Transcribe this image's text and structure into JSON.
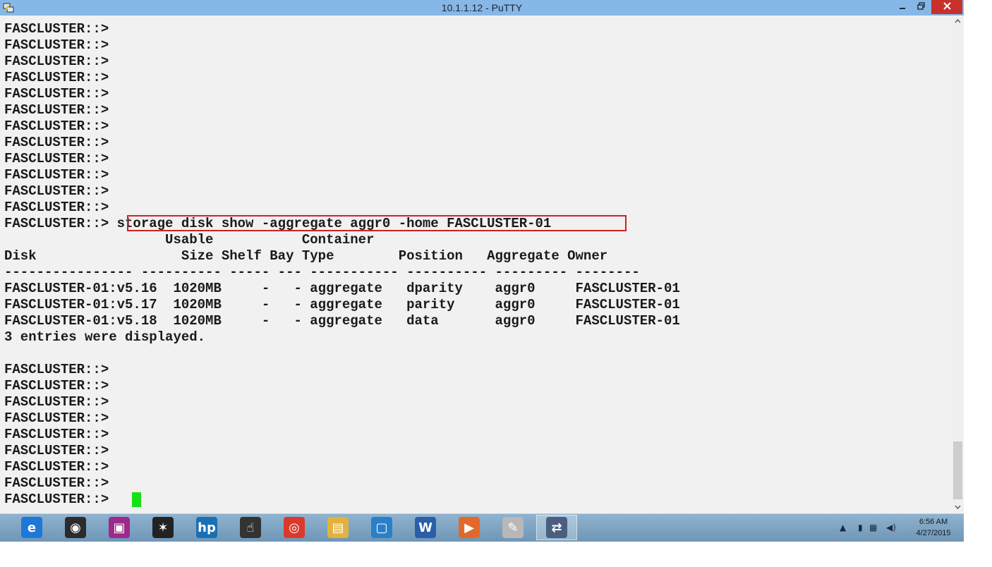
{
  "window": {
    "title": "10.1.1.12 - PuTTY",
    "minimize_icon": "minimize-icon",
    "restore_icon": "restore-icon",
    "close_icon": "close-icon"
  },
  "terminal": {
    "lines": [
      "FASCLUSTER::>",
      "FASCLUSTER::>",
      "FASCLUSTER::>",
      "FASCLUSTER::>",
      "FASCLUSTER::>",
      "FASCLUSTER::>",
      "FASCLUSTER::>",
      "FASCLUSTER::>",
      "FASCLUSTER::>",
      "FASCLUSTER::>",
      "FASCLUSTER::>",
      "FASCLUSTER::>",
      "FASCLUSTER::> storage disk show -aggregate aggr0 -home FASCLUSTER-01",
      "                    Usable           Container",
      "Disk                  Size Shelf Bay Type        Position   Aggregate Owner",
      "---------------- ---------- ----- --- ----------- ---------- --------- --------",
      "FASCLUSTER-01:v5.16  1020MB     -   - aggregate   dparity    aggr0     FASCLUSTER-01",
      "FASCLUSTER-01:v5.17  1020MB     -   - aggregate   parity     aggr0     FASCLUSTER-01",
      "FASCLUSTER-01:v5.18  1020MB     -   - aggregate   data       aggr0     FASCLUSTER-01",
      "3 entries were displayed.",
      "",
      "FASCLUSTER::>",
      "FASCLUSTER::>",
      "FASCLUSTER::>",
      "FASCLUSTER::>",
      "FASCLUSTER::>",
      "FASCLUSTER::>",
      "FASCLUSTER::>",
      "FASCLUSTER::>",
      "FASCLUSTER::>"
    ],
    "highlighted_command": "storage disk show -aggregate aggr0 -home FASCLUSTER-01",
    "cursor_color": "#16e116",
    "highlight_color": "#d11f25"
  },
  "taskbar": {
    "items": [
      {
        "icon": "internet-explorer-icon",
        "active": false
      },
      {
        "icon": "media-player-icon",
        "active": false
      },
      {
        "icon": "remote-display-icon",
        "active": false
      },
      {
        "icon": "color-app-icon",
        "active": false
      },
      {
        "icon": "hp-icon",
        "active": false
      },
      {
        "icon": "touch-app-icon",
        "active": false
      },
      {
        "icon": "chrome-icon",
        "active": false
      },
      {
        "icon": "file-explorer-icon",
        "active": false
      },
      {
        "icon": "vmware-icon",
        "active": false
      },
      {
        "icon": "word-icon",
        "active": false
      },
      {
        "icon": "video-app-icon",
        "active": false
      },
      {
        "icon": "paint-icon",
        "active": false
      },
      {
        "icon": "putty-icon",
        "active": true
      }
    ],
    "tray": {
      "time": "6:56 AM",
      "date": "4/27/2015"
    }
  }
}
